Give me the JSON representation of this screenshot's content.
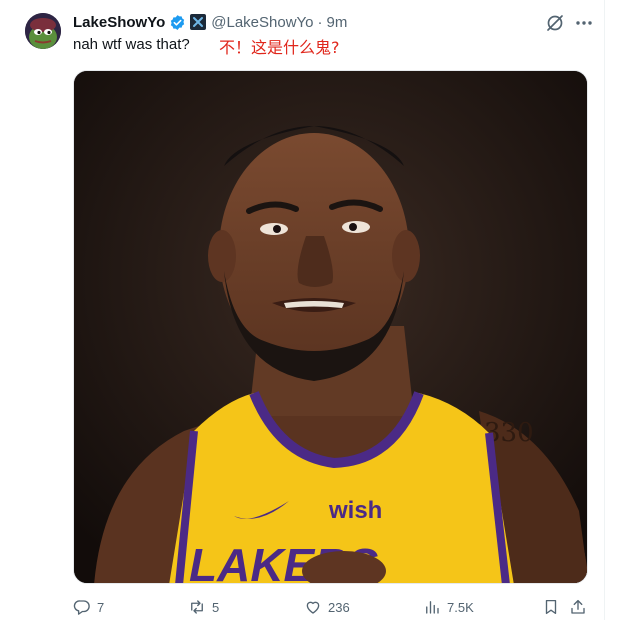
{
  "tweet": {
    "author": {
      "display_name": "LakeShowYo",
      "handle": "@LakeShowYo",
      "verified": true,
      "avatar_icon": "pepe-frog-avatar"
    },
    "separator": "·",
    "time": "9m",
    "text": "nah wtf was that?",
    "translation": "不！这是什么鬼?",
    "media": {
      "description_icon": "photo-basketball-player",
      "jersey_sponsor": "wish",
      "jersey_team": "LAKERS"
    },
    "actions": {
      "reply_count": "7",
      "retweet_count": "5",
      "like_count": "236",
      "view_count": "7.5K"
    }
  },
  "colors": {
    "text_primary": "#0f1419",
    "text_secondary": "#536471",
    "translation_red": "#e0261b",
    "verified_blue": "#1d9bf0",
    "lakers_gold": "#f5c518",
    "lakers_purple": "#4b2a86"
  }
}
